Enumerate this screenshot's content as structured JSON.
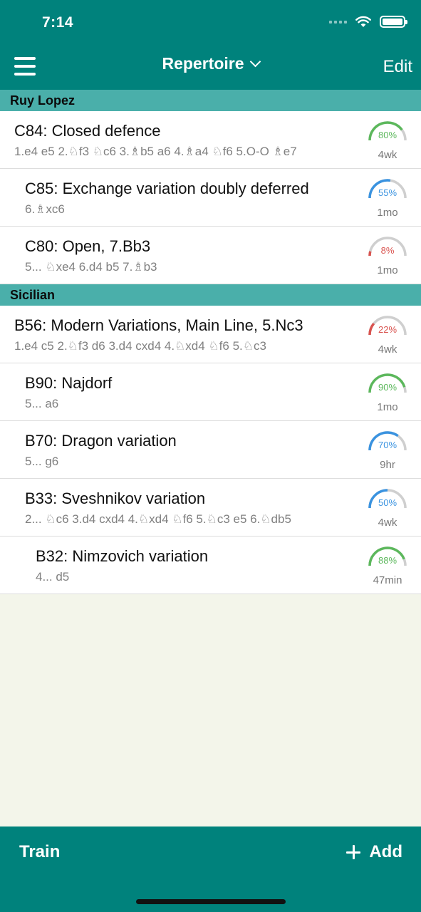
{
  "status": {
    "time": "7:14"
  },
  "nav": {
    "title": "Repertoire",
    "edit_label": "Edit"
  },
  "sections": [
    {
      "header": "Ruy Lopez",
      "rows": [
        {
          "level": 0,
          "title": "C84: Closed defence",
          "moves": "1.e4 e5 2.♘f3 ♘c6 3.♗b5 a6 4.♗a4 ♘f6 5.O-O ♗e7",
          "percent": 80,
          "percent_label": "80%",
          "age": "4wk",
          "color": "#5cb85c"
        },
        {
          "level": 1,
          "title": "C85: Exchange variation doubly deferred",
          "moves": "6.♗xc6",
          "percent": 55,
          "percent_label": "55%",
          "age": "1mo",
          "color": "#3a93e0"
        },
        {
          "level": 1,
          "title": "C80: Open, 7.Bb3",
          "moves": "5... ♘xe4 6.d4 b5 7.♗b3",
          "percent": 8,
          "percent_label": "8%",
          "age": "1mo",
          "color": "#d9534f"
        }
      ]
    },
    {
      "header": "Sicilian",
      "rows": [
        {
          "level": 0,
          "title": "B56: Modern Variations, Main Line, 5.Nc3",
          "moves": "1.e4 c5 2.♘f3 d6 3.d4 cxd4 4.♘xd4 ♘f6 5.♘c3",
          "percent": 22,
          "percent_label": "22%",
          "age": "4wk",
          "color": "#d9534f"
        },
        {
          "level": 1,
          "title": "B90: Najdorf",
          "moves": "5... a6",
          "percent": 90,
          "percent_label": "90%",
          "age": "1mo",
          "color": "#5cb85c"
        },
        {
          "level": 1,
          "title": "B70: Dragon variation",
          "moves": "5... g6",
          "percent": 70,
          "percent_label": "70%",
          "age": "9hr",
          "color": "#3a93e0"
        },
        {
          "level": 1,
          "title": "B33: Sveshnikov variation",
          "moves": "2... ♘c6 3.d4 cxd4 4.♘xd4 ♘f6 5.♘c3 e5 6.♘db5",
          "percent": 50,
          "percent_label": "50%",
          "age": "4wk",
          "color": "#3a93e0"
        },
        {
          "level": 2,
          "title": "B32: Nimzovich variation",
          "moves": "4... d5",
          "percent": 88,
          "percent_label": "88%",
          "age": "47min",
          "color": "#5cb85c"
        }
      ]
    }
  ],
  "bottom": {
    "train_label": "Train",
    "add_label": "Add"
  }
}
